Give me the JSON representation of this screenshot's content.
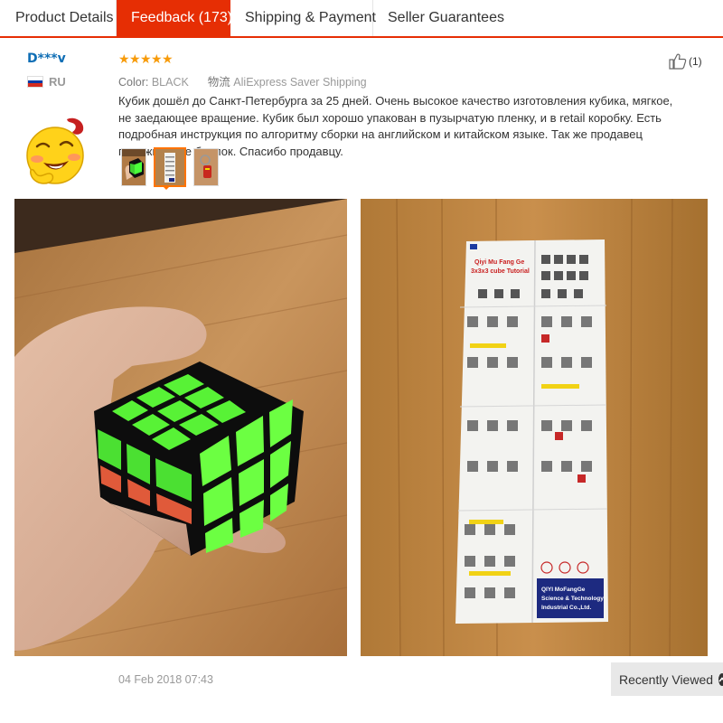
{
  "tabs": [
    {
      "label": "Product Details",
      "active": false
    },
    {
      "label": "Feedback (173)",
      "active": true
    },
    {
      "label": "Shipping & Payment",
      "active": false
    },
    {
      "label": "Seller Guarantees",
      "active": false
    }
  ],
  "review": {
    "reviewer": "D***v",
    "country_code": "RU",
    "rating_stars": 5,
    "color_label": "Color:",
    "color_value": "BLACK",
    "shipping_label": "物流",
    "shipping_value": "AliExpress Saver Shipping",
    "text": "Кубик дошёл до Санкт-Петербурга за 25 дней. Очень высокое качество изготовления кубика, мягкое, не заедающее вращение. Кубик был хорошо упакован в пузырчатую пленку, и в retail коробку. Есть подробная инструкция по алгоритму сборки на английском и китайском языке. Так же продавец положил еще брелок. Спасибо продавцу.",
    "helpful_count": "(1)",
    "date": "04 Feb 2018 07:43",
    "thumbnails_count": 3,
    "selected_thumbnail": 2
  },
  "manual_text": {
    "brand": "Qiyi Mu Fang Ge",
    "title": "3x3x3 cube Tutorial",
    "company_line1": "QIYI MoFangGe",
    "company_line2": "Science & Technology",
    "company_line3": "Industrial Co.,Ltd."
  },
  "recently_viewed": {
    "label": "Recently Viewed"
  },
  "colors": {
    "accent": "#e62e04",
    "star": "#f79b0a",
    "reviewer_name": "#0f6eb5",
    "thumbnail_selected": "#ff7300"
  },
  "icons": [
    "thumbs-up-icon",
    "russia-flag-icon",
    "emoji-avatar-icon",
    "chevron-up-icon",
    "star-icon"
  ]
}
